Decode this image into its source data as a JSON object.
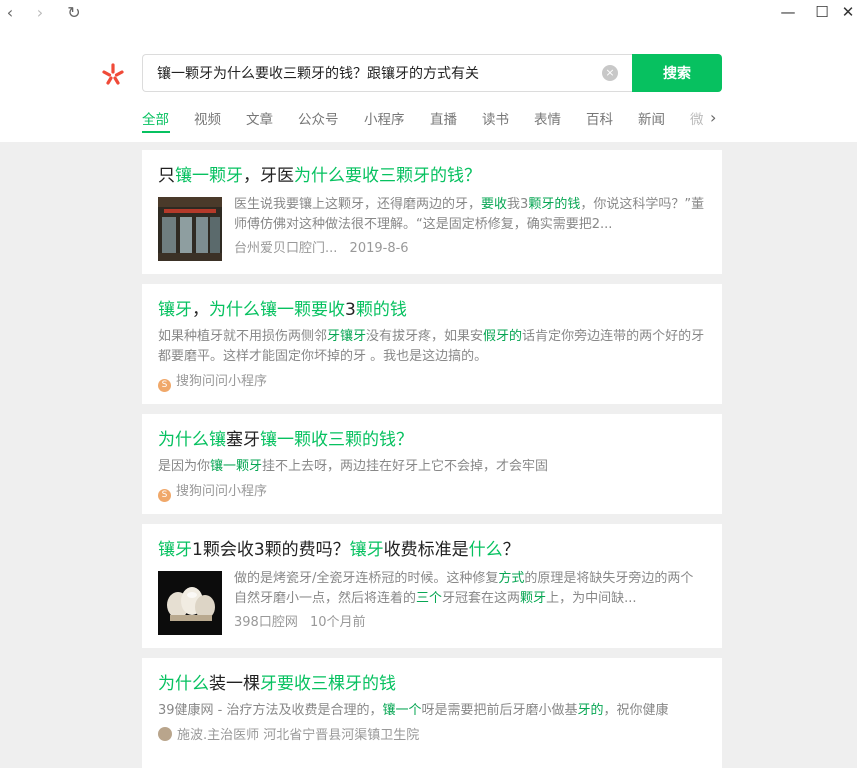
{
  "window": {
    "back_glyph": "‹",
    "forward_glyph": "›",
    "refresh_glyph": "↻",
    "minimize_glyph": "—",
    "maximize_glyph": "☐",
    "close_glyph": "✕"
  },
  "search": {
    "query": "镶一颗牙为什么要收三颗牙的钱？跟镶牙的方式有关",
    "clear_glyph": "×",
    "button_label": "搜索"
  },
  "tabs": [
    "全部",
    "视频",
    "文章",
    "公众号",
    "小程序",
    "直播",
    "读书",
    "表情",
    "百科",
    "新闻",
    "微"
  ],
  "tabs_more_glyph": "›",
  "results": [
    {
      "title": [
        {
          "t": "只",
          "h": false
        },
        {
          "t": "镶一颗牙",
          "h": true
        },
        {
          "t": "，牙医",
          "h": false
        },
        {
          "t": "为什么要收三颗牙的钱？",
          "h": true
        }
      ],
      "snippet": [
        {
          "t": "医生说我要镶上这颗牙，还得磨两边的牙，",
          "h": false
        },
        {
          "t": "要收",
          "h": true
        },
        {
          "t": "我3",
          "h": false
        },
        {
          "t": "颗牙的钱",
          "h": true
        },
        {
          "t": "，你说这科学吗？”董师傅仿佛对这种做法很不理解。“这是固定桥修复，确实需要把2...",
          "h": false
        }
      ],
      "source": "台州爱贝口腔门...",
      "date": "2019-8-6"
    },
    {
      "title": [
        {
          "t": "镶牙",
          "h": true
        },
        {
          "t": "，",
          "h": false
        },
        {
          "t": "为什么镶一颗要收",
          "h": true
        },
        {
          "t": "3",
          "h": false
        },
        {
          "t": "颗的钱",
          "h": true
        }
      ],
      "snippet": [
        {
          "t": "如果种植牙就不用损伤两侧邻",
          "h": false
        },
        {
          "t": "牙镶牙",
          "h": true
        },
        {
          "t": "没有拔牙疼，如果安",
          "h": false
        },
        {
          "t": "假牙的",
          "h": true
        },
        {
          "t": "话肯定你旁边连带的两个好的牙都要磨平。这样才能固定你坏掉的牙 。我也是这边搞的。",
          "h": false
        }
      ],
      "source": "搜狗问问小程序",
      "badge": "S"
    },
    {
      "title": [
        {
          "t": "为什么镶",
          "h": true
        },
        {
          "t": "塞牙",
          "h": false
        },
        {
          "t": "镶一颗收三颗的钱？",
          "h": true
        }
      ],
      "snippet": [
        {
          "t": "是因为你",
          "h": false
        },
        {
          "t": "镶一颗牙",
          "h": true
        },
        {
          "t": "挂不上去呀，两边挂在好牙上它不会掉，才会牢固",
          "h": false
        }
      ],
      "source": "搜狗问问小程序",
      "badge": "S"
    },
    {
      "title": [
        {
          "t": "镶牙",
          "h": true
        },
        {
          "t": "1颗会收3颗的费吗？",
          "h": false
        },
        {
          "t": "镶牙",
          "h": true
        },
        {
          "t": "收费标准是",
          "h": false
        },
        {
          "t": "什么",
          "h": true
        },
        {
          "t": "？",
          "h": false
        }
      ],
      "snippet": [
        {
          "t": "做的是烤瓷牙/全瓷牙连桥冠的时候。这种修复",
          "h": false
        },
        {
          "t": "方式",
          "h": true
        },
        {
          "t": "的原理是将缺失牙旁边的两个自然牙磨小一点，然后将连着的",
          "h": false
        },
        {
          "t": "三个",
          "h": true
        },
        {
          "t": "牙冠套在这两",
          "h": false
        },
        {
          "t": "颗牙",
          "h": true
        },
        {
          "t": "上，为中间缺...",
          "h": false
        }
      ],
      "source": "398口腔网",
      "date": "10个月前"
    },
    {
      "title": [
        {
          "t": "为什么",
          "h": true
        },
        {
          "t": "装一棵",
          "h": false
        },
        {
          "t": "牙要收三棵",
          "h": true
        },
        {
          "t": "牙的钱",
          "h": true
        }
      ],
      "snippet": [
        {
          "t": "39健康网 - 治疗方法及收费是合理的，",
          "h": false
        },
        {
          "t": "镶一个",
          "h": true
        },
        {
          "t": "呀是需要把前后牙磨小做基",
          "h": false
        },
        {
          "t": "牙的",
          "h": true
        },
        {
          "t": "，祝你健康",
          "h": false
        }
      ],
      "source": "施波.主治医师 河北省宁晋县河渠镇卫生院"
    }
  ]
}
